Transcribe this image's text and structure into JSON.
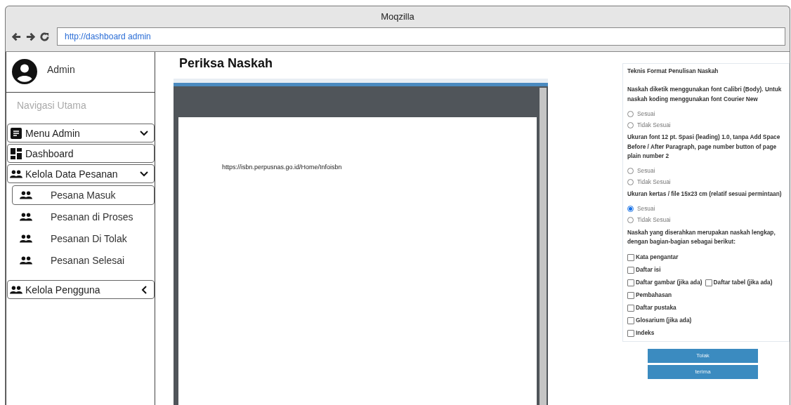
{
  "window": {
    "title": "Moqzilla"
  },
  "address_bar": {
    "value": "http://dashboard admin"
  },
  "sidebar": {
    "user": "Admin",
    "section_label": "Navigasi Utama",
    "items": [
      {
        "kind": "menu",
        "label": "Menu Admin",
        "expanded": true
      },
      {
        "kind": "grid",
        "label": "Dashboard"
      },
      {
        "kind": "people",
        "label": "Kelola Data Pesanan",
        "expanded": true,
        "children": [
          {
            "label": "Pesana Masuk",
            "selected": true
          },
          {
            "label": "Pesanan di Proses",
            "selected": false
          },
          {
            "label": "Pesanan Di Tolak",
            "selected": false
          },
          {
            "label": "Pesanan Selesai",
            "selected": false
          }
        ]
      },
      {
        "kind": "people",
        "label": "Kelola Pengguna",
        "expanded": false
      }
    ]
  },
  "main": {
    "title": "Periksa Naskah",
    "document": {
      "text": "https://isbn.perpusnas.go.id/Home/Infoisbn"
    }
  },
  "form": {
    "title": "Teknis Format Penulisan Naskah",
    "questions": [
      {
        "kind": "radio",
        "text": "Naskah diketik menggunakan font Calibri (Body). Untuk naskah koding menggunakan font Courier New",
        "options": [
          {
            "label": "Sesuai",
            "selected": false
          },
          {
            "label": "Tidak Sesuai",
            "selected": false
          }
        ]
      },
      {
        "kind": "radio",
        "text": "Ukuran font 12 pt. Spasi (leading) 1.0, tanpa Add Space Before / After Paragraph, page number button of page plain number 2",
        "options": [
          {
            "label": "Sesuai",
            "selected": false
          },
          {
            "label": "Tidak Sesuai",
            "selected": false
          }
        ]
      },
      {
        "kind": "radio",
        "text": "Ukuran kertas / file 15x23 cm (relatif sesuai permintaan)",
        "options": [
          {
            "label": "Sesuai",
            "selected": true
          },
          {
            "label": "Tidak Sesuai",
            "selected": false
          }
        ]
      },
      {
        "kind": "checkbox",
        "text": "Naskah yang diserahkan merupakan naskah lengkap, dengan bagian-bagian sebagai berikut:",
        "rows": [
          [
            {
              "label": "Kata pengantar",
              "checked": false
            }
          ],
          [
            {
              "label": "Daftar isi",
              "checked": false
            }
          ],
          [
            {
              "label": "Daftar gambar (jika ada)",
              "checked": false
            },
            {
              "label": "Daftar tabel (jika ada)",
              "checked": false
            }
          ],
          [
            {
              "label": "Pembahasan",
              "checked": false
            }
          ],
          [
            {
              "label": "Daftar pustaka",
              "checked": false
            }
          ],
          [
            {
              "label": "Glosarium (jika ada)",
              "checked": false
            }
          ],
          [
            {
              "label": "Indeks",
              "checked": false
            }
          ]
        ]
      }
    ]
  },
  "buttons": [
    "Tolak",
    "terima"
  ]
}
